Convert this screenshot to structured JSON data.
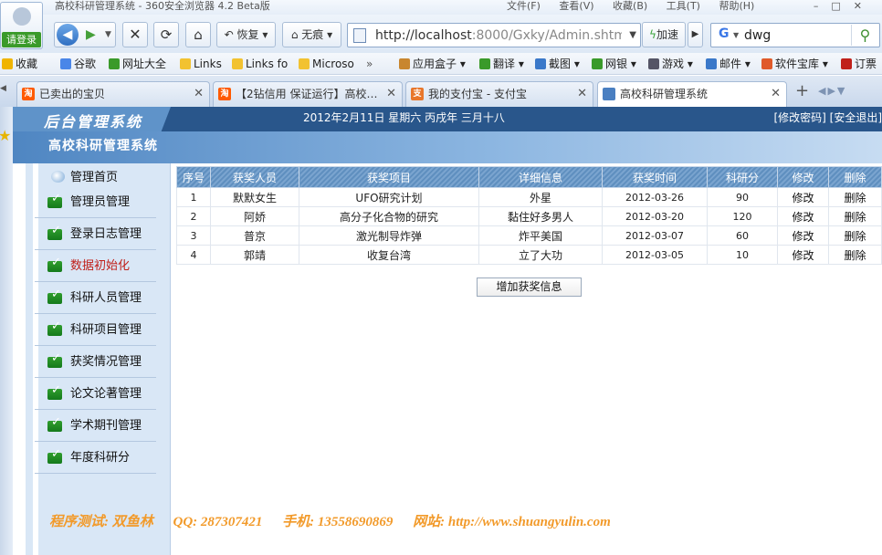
{
  "browser": {
    "window_title": "高校科研管理系统 - 360安全浏览器 4.2 Beta版",
    "menu": [
      "文件(F)",
      "查看(V)",
      "收藏(B)",
      "工具(T)",
      "帮助(H)"
    ],
    "login_label": "请登录",
    "restore_label": "恢复",
    "incognito_label": "无痕",
    "address": {
      "host": "http://localhost",
      "rest": ":8000/Gxky/Admin.shtm"
    },
    "speed_label": "加速",
    "search_query": "dwg",
    "bookmarks": [
      "收藏",
      "谷歌",
      "网址大全",
      "Links",
      "Links fo",
      "Microso",
      "应用盒子",
      "翻译",
      "截图",
      "网银",
      "游戏",
      "邮件",
      "软件宝库",
      "订票"
    ],
    "tabs": [
      {
        "label": "已卖出的宝贝",
        "fav": "淘",
        "color": "#ff5a00"
      },
      {
        "label": "【2钻信用 保证运行】高校…",
        "fav": "淘",
        "color": "#ff5a00"
      },
      {
        "label": "我的支付宝 - 支付宝",
        "fav": "支",
        "color": "#e8762b"
      },
      {
        "label": "高校科研管理系统",
        "fav": "",
        "color": "#4a7fc1"
      }
    ]
  },
  "app": {
    "logo_text": "后台管理系统",
    "date_text": "2012年2月11日 星期六 丙戌年 三月十八",
    "top_links": "[修改密码] [安全退出]",
    "system_title": "高校科研管理系统",
    "home_label": "管理首页",
    "nav": [
      {
        "label": "管理员管理",
        "active": false
      },
      {
        "label": "登录日志管理",
        "active": false
      },
      {
        "label": "数据初始化",
        "active": true
      },
      {
        "label": "科研人员管理",
        "active": false
      },
      {
        "label": "科研项目管理",
        "active": false
      },
      {
        "label": "获奖情况管理",
        "active": false
      },
      {
        "label": "论文论著管理",
        "active": false
      },
      {
        "label": "学术期刊管理",
        "active": false
      },
      {
        "label": "年度科研分",
        "active": false
      }
    ],
    "table": {
      "headers": [
        "序号",
        "获奖人员",
        "获奖项目",
        "详细信息",
        "获奖时间",
        "科研分",
        "修改",
        "删除"
      ],
      "rows": [
        {
          "no": "1",
          "person": "默默女生",
          "project": "UFO研究计划",
          "detail": "外星",
          "date": "2012-03-26",
          "score": "90",
          "edit": "修改",
          "del": "删除"
        },
        {
          "no": "2",
          "person": "阿娇",
          "project": "高分子化合物的研究",
          "detail": "黏住好多男人",
          "date": "2012-03-20",
          "score": "120",
          "edit": "修改",
          "del": "删除"
        },
        {
          "no": "3",
          "person": "普京",
          "project": "激光制导炸弹",
          "detail": "炸平美国",
          "date": "2012-03-07",
          "score": "60",
          "edit": "修改",
          "del": "删除"
        },
        {
          "no": "4",
          "person": "郭靖",
          "project": "收复台湾",
          "detail": "立了大功",
          "date": "2012-03-05",
          "score": "10",
          "edit": "修改",
          "del": "删除"
        }
      ]
    },
    "add_button": "增加获奖信息",
    "footer": [
      "程序测试: 双鱼林",
      "QQ: 287307421",
      "手机: 13558690869",
      "网站: http://www.shuangyulin.com"
    ]
  }
}
